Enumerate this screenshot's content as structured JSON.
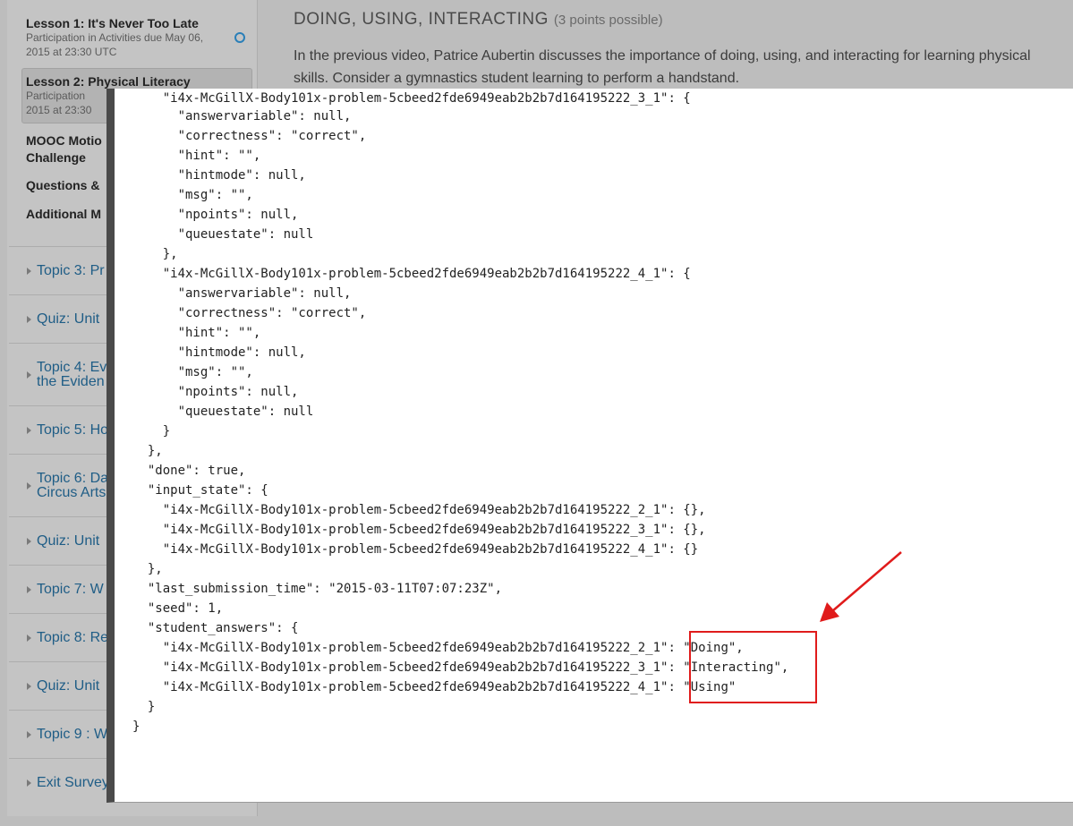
{
  "sidebar": {
    "lesson1": {
      "title": "Lesson 1: It's Never Too Late",
      "sub1": "Participation in Activities due May 06,",
      "sub2": "2015 at 23:30 UTC"
    },
    "lesson2": {
      "title": "Lesson 2: Physical Literacy",
      "sub1": "Participation",
      "sub2": "2015 at 23:30"
    },
    "links": [
      "MOOC Motio",
      "Challenge",
      "Questions &",
      "Additional M"
    ],
    "topics": [
      "Topic 3: Pr",
      "Quiz: Unit",
      "Topic 4: Ev",
      "the Eviden",
      "Topic 5: Ho",
      "Topic 6: Da",
      "Circus Arts",
      "Quiz: Unit",
      "Topic 7: W",
      "Topic 8: Re",
      "Quiz: Unit",
      "Topic 9 : W",
      "Exit Survey"
    ]
  },
  "main": {
    "heading": "DOING, USING, INTERACTING",
    "points": "(3 points possible)",
    "text": "In the previous video, Patrice Aubertin discusses the importance of doing, using, and interacting for learning physical skills. Consider a gymnastics student learning to perform a handstand."
  },
  "code_lines": [
    "    \"i4x-McGillX-Body101x-problem-5cbeed2fde6949eab2b2b7d164195222_3_1\": {",
    "      \"answervariable\": null,",
    "      \"correctness\": \"correct\",",
    "      \"hint\": \"\",",
    "      \"hintmode\": null,",
    "      \"msg\": \"\",",
    "      \"npoints\": null,",
    "      \"queuestate\": null",
    "    },",
    "    \"i4x-McGillX-Body101x-problem-5cbeed2fde6949eab2b2b7d164195222_4_1\": {",
    "      \"answervariable\": null,",
    "      \"correctness\": \"correct\",",
    "      \"hint\": \"\",",
    "      \"hintmode\": null,",
    "      \"msg\": \"\",",
    "      \"npoints\": null,",
    "      \"queuestate\": null",
    "    }",
    "  },",
    "  \"done\": true,",
    "  \"input_state\": {",
    "    \"i4x-McGillX-Body101x-problem-5cbeed2fde6949eab2b2b7d164195222_2_1\": {},",
    "    \"i4x-McGillX-Body101x-problem-5cbeed2fde6949eab2b2b7d164195222_3_1\": {},",
    "    \"i4x-McGillX-Body101x-problem-5cbeed2fde6949eab2b2b7d164195222_4_1\": {}",
    "  },",
    "  \"last_submission_time\": \"2015-03-11T07:07:23Z\",",
    "  \"seed\": 1,",
    "  \"student_answers\": {",
    "    \"i4x-McGillX-Body101x-problem-5cbeed2fde6949eab2b2b7d164195222_2_1\": \"Doing\",",
    "    \"i4x-McGillX-Body101x-problem-5cbeed2fde6949eab2b2b7d164195222_3_1\": \"Interacting\",",
    "    \"i4x-McGillX-Body101x-problem-5cbeed2fde6949eab2b2b7d164195222_4_1\": \"Using\"",
    "  }",
    "}"
  ],
  "colors": {
    "highlight": "#e01b1b",
    "link": "#1f5d86"
  }
}
